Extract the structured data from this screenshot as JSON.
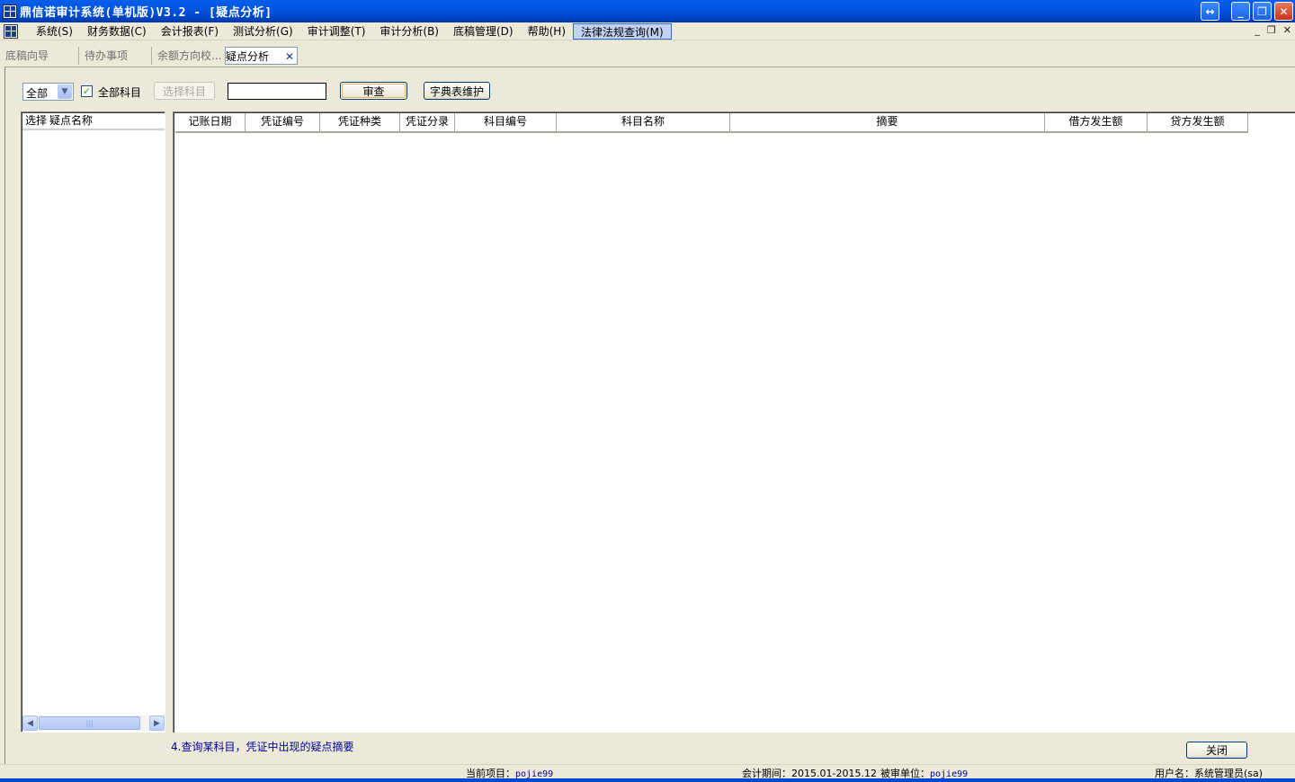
{
  "window": {
    "title": "鼎信诺审计系统(单机版)V3.2 - [疑点分析]",
    "buttons": {
      "extra": "↔",
      "minimize": "_",
      "restore": "❐",
      "close": "✕"
    }
  },
  "menu": {
    "items": [
      "系统(S)",
      "财务数据(C)",
      "会计报表(F)",
      "测试分析(G)",
      "审计调整(T)",
      "审计分析(B)",
      "底稿管理(D)",
      "帮助(H)",
      "法律法规查询(M)"
    ],
    "mdi_controls": [
      "_",
      "❐",
      "✕"
    ]
  },
  "tabs": [
    {
      "label": "底稿向导"
    },
    {
      "label": "待办事项"
    },
    {
      "label": "余额方向校..."
    },
    {
      "label": "疑点分析",
      "close": "✕"
    }
  ],
  "toolbar": {
    "scope_value": "全部",
    "all_subjects_checked": true,
    "all_subjects_label": "全部科目",
    "select_subject_label": "选择科目",
    "search_value": "",
    "review_label": "审查",
    "dictionary_label": "字典表维护"
  },
  "left_list": {
    "columns": [
      "选择",
      "疑点名称"
    ],
    "rows": []
  },
  "grid": {
    "columns": [
      "记账日期",
      "凭证编号",
      "凭证种类",
      "凭证分录",
      "科目编号",
      "科目名称",
      "摘要",
      "借方发生额",
      "贷方发生额"
    ],
    "rows": []
  },
  "hint": "4.查询某科目，凭证中出现的疑点摘要",
  "close_label": "关闭",
  "status": {
    "project_label": "当前项目：",
    "project_value": "pojie99",
    "period_label": "会计期间：",
    "period_value": "2015.01-2015.12",
    "auditee_label": "被审单位：",
    "auditee_value": "pojie99",
    "user_label": "用户名：",
    "user_value": "系统管理员(sa)"
  },
  "icons": {
    "app": "app-logo-icon",
    "dropdown": "chevron-down-icon",
    "scroll_left": "arrow-left-icon",
    "scroll_right": "arrow-right-icon",
    "check": "check-icon"
  }
}
